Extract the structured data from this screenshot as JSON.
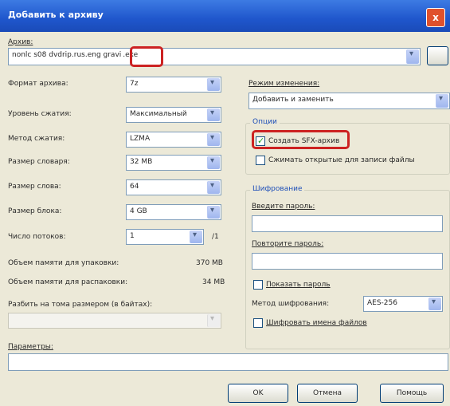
{
  "window": {
    "title": "Добавить к архиву",
    "close_symbol": "x"
  },
  "archive": {
    "label": "Архив:",
    "path": "nonlc s08 dvdrip.rus.eng gravi",
    "ext": ".exe",
    "browse_label": ""
  },
  "left": {
    "format_label": "Формат архива:",
    "format_value": "7z",
    "level_label": "Уровень сжатия:",
    "level_value": "Максимальный",
    "method_label": "Метод сжатия:",
    "method_value": "LZMA",
    "dict_label": "Размер словаря:",
    "dict_value": "32 MB",
    "word_label": "Размер слова:",
    "word_value": "64",
    "block_label": "Размер блока:",
    "block_value": "4 GB",
    "threads_label": "Число потоков:",
    "threads_value": "1",
    "threads_max": "/1",
    "mem_pack_label": "Объем памяти для упаковки:",
    "mem_pack_value": "370 MB",
    "mem_unpack_label": "Объем памяти для распаковки:",
    "mem_unpack_value": "34 MB",
    "split_label": "Разбить на тома размером (в байтах):",
    "split_value": ""
  },
  "right": {
    "update_label": "Режим изменения:",
    "update_value": "Добавить и заменить",
    "options_title": "Опции",
    "sfx_label": "Создать SFX-архив",
    "shared_label": "Сжимать открытые для записи файлы",
    "encrypt_title": "Шифрование",
    "pass_label": "Введите пароль:",
    "repeat_label": "Повторите пароль:",
    "show_pass_label": "Показать пароль",
    "enc_method_label": "Метод шифрования:",
    "enc_method_value": "AES-256",
    "enc_names_label": "Шифровать имена файлов"
  },
  "params": {
    "label": "Параметры:",
    "value": ""
  },
  "buttons": {
    "ok": "OK",
    "cancel": "Отмена",
    "help": "Помощь"
  },
  "colors": {
    "highlight": "#cc2222",
    "titlebar": "#1f56cc"
  }
}
